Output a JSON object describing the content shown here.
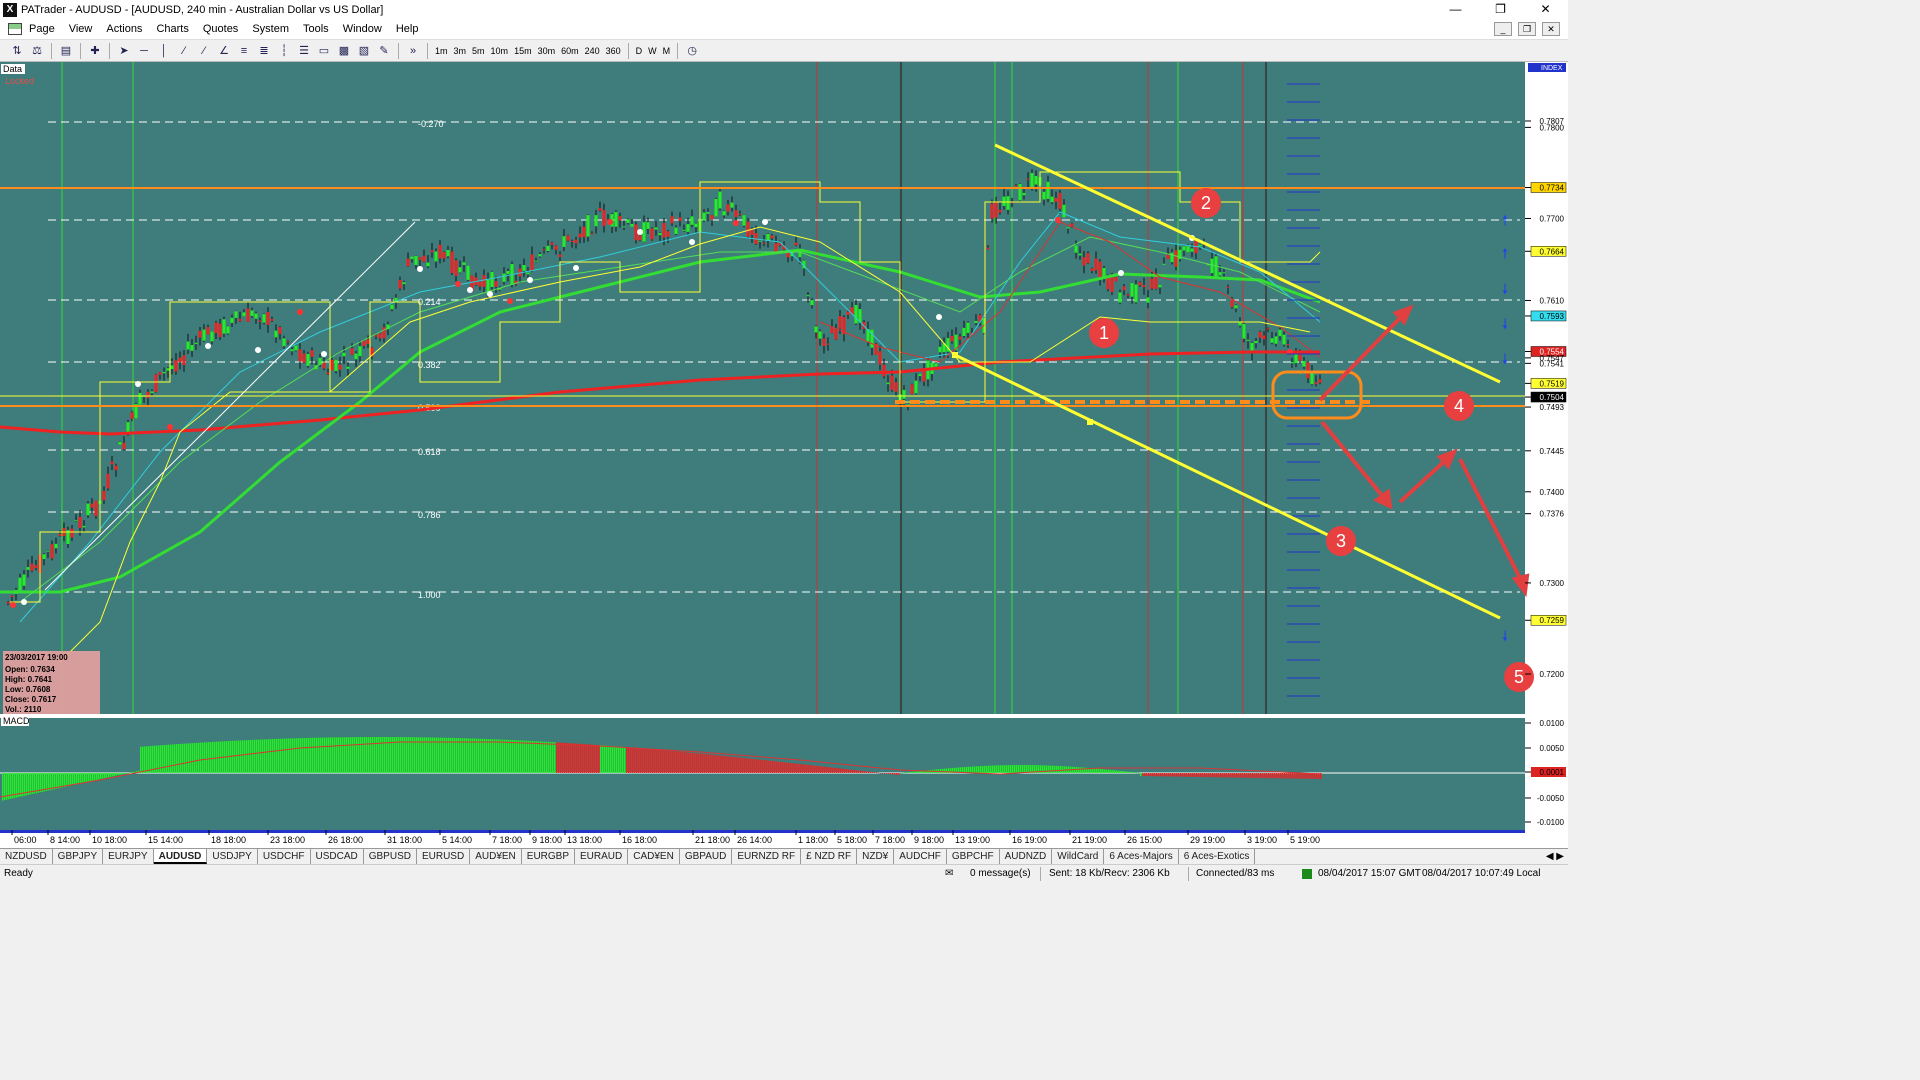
{
  "window": {
    "title": "PATrader - AUDUSD - [AUDUSD, 240 min - Australian Dollar vs US Dollar]",
    "app_letter": "X"
  },
  "menu": [
    "Page",
    "View",
    "Actions",
    "Charts",
    "Quotes",
    "System",
    "Tools",
    "Window",
    "Help"
  ],
  "toolbar": {
    "timeframes": [
      "1m",
      "3m",
      "5m",
      "10m",
      "15m",
      "30m",
      "60m",
      "240",
      "360"
    ],
    "periods": [
      "D",
      "W",
      "M"
    ]
  },
  "chart": {
    "data_label": "Data",
    "locked_label": "Locked",
    "index_label": "INDEX",
    "macd_label": "MACD",
    "fib_labels": [
      "-0.270",
      "0.214",
      "0.382",
      "0.500",
      "0.618",
      "0.786",
      "1.000"
    ],
    "price_axis": [
      "0.7807",
      "0.7800",
      "0.7734",
      "0.7700",
      "0.7664",
      "0.7610",
      "0.7593",
      "0.7554",
      "0.7547",
      "0.7541",
      "0.7519",
      "0.7504",
      "0.7493",
      "0.7445",
      "0.7400",
      "0.7376",
      "0.7300",
      "0.7259",
      "0.7200"
    ],
    "macd_axis": [
      "0.0100",
      "0.0050",
      "0.0001",
      "-0.0050",
      "-0.0100"
    ],
    "time_axis": [
      "06:00",
      "8 14:00",
      "10 18:00",
      "15 14:00",
      "18 18:00",
      "23 18:00",
      "26 18:00",
      "31 18:00",
      "5 14:00",
      "7 18:00",
      "9 18:00",
      "13 18:00",
      "16 18:00",
      "21 18:00",
      "26 14:00",
      "1 18:00",
      "5 18:00",
      "7 18:00",
      "9 18:00",
      "13 19:00",
      "16 19:00",
      "21 19:00",
      "26 15:00",
      "29 19:00",
      "3 19:00",
      "5 19:00"
    ],
    "annotations": [
      "1",
      "2",
      "3",
      "4",
      "5"
    ],
    "info_box": {
      "date": "23/03/2017 19:00",
      "open": "Open: 0.7634",
      "high": "High: 0.7641",
      "low": "Low: 0.7608",
      "close": "Close: 0.7617",
      "vol": "Vol.: 2110"
    },
    "colors": {
      "background": "#3e7d7b",
      "grid": "#ffffff",
      "bull": "#22ee22",
      "bear": "#ee2222",
      "fast_ma": "#33dd33",
      "slow_ma": "#ee2222",
      "channel": "#ffff33",
      "horizontal": "#ff8c1a"
    }
  },
  "tabs": [
    "NZDUSD",
    "GBPJPY",
    "EURJPY",
    "AUDUSD",
    "USDJPY",
    "USDCHF",
    "USDCAD",
    "GBPUSD",
    "EURUSD",
    "AUD¥EN",
    "EURGBP",
    "EURAUD",
    "CAD¥EN",
    "GBPAUD",
    "EURNZD RF",
    "£ NZD RF",
    "NZD¥",
    "AUDCHF",
    "GBPCHF",
    "AUDNZD",
    "WildCard",
    "6 Aces-Majors",
    "6 Aces-Exotics"
  ],
  "active_tab": "AUDUSD",
  "status": {
    "ready": "Ready",
    "messages": "0 message(s)",
    "traffic": "Sent: 18 Kb/Recv: 2306 Kb",
    "connection": "Connected/83 ms",
    "gmt_time": "08/04/2017 15:07 GMT",
    "local_time": "08/04/2017 10:07:49 Local"
  }
}
